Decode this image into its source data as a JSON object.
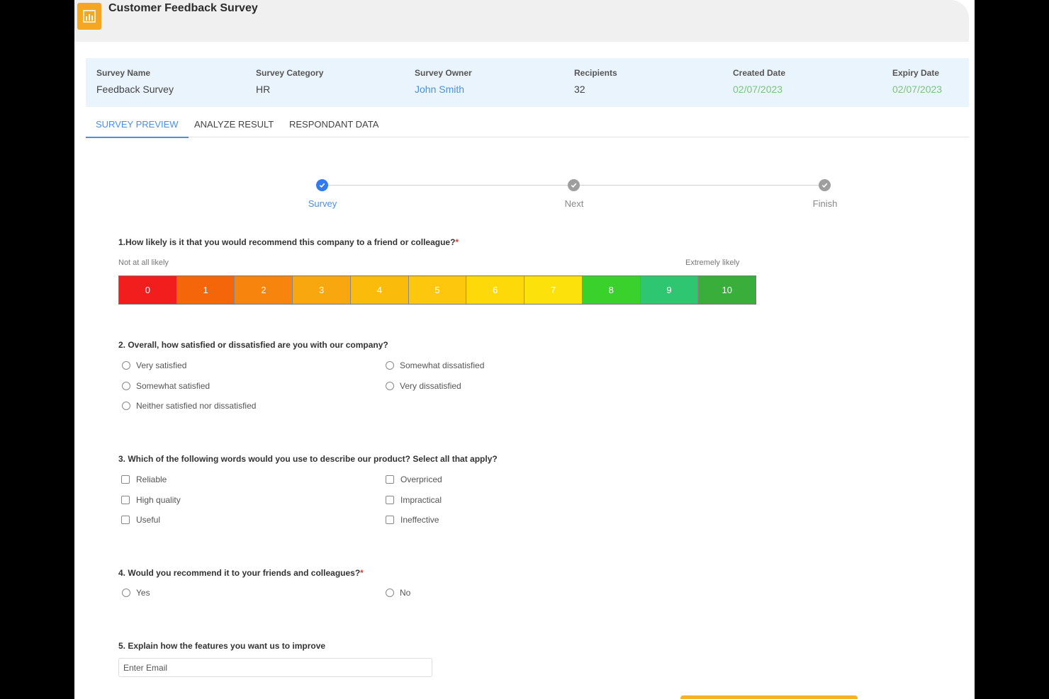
{
  "header": {
    "title": "Customer Feedback Survey"
  },
  "info": [
    {
      "label": "Survey Name",
      "value": "Feedback Survey",
      "style": "plain"
    },
    {
      "label": "Survey Category",
      "value": "HR",
      "style": "plain"
    },
    {
      "label": "Survey Owner",
      "value": "John Smith",
      "style": "link"
    },
    {
      "label": "Recipients",
      "value": "32",
      "style": "plain"
    },
    {
      "label": "Created Date",
      "value": "02/07/2023",
      "style": "green"
    },
    {
      "label": "Expiry Date",
      "value": "02/07/2023",
      "style": "green"
    }
  ],
  "tabs": [
    {
      "label": "SURVEY PREVIEW",
      "active": true
    },
    {
      "label": "ANALYZE RESULT",
      "active": false
    },
    {
      "label": "RESPONDANT DATA",
      "active": false
    }
  ],
  "stepper": [
    {
      "label": "Survey",
      "active": true
    },
    {
      "label": "Next",
      "active": false
    },
    {
      "label": "Finish",
      "active": false
    }
  ],
  "q1": {
    "title": "1.How likely is it that you would recommend this company to a friend or colleague?",
    "required": "*",
    "low_label": "Not at all likely",
    "high_label": "Extremely likely",
    "scale": [
      "0",
      "1",
      "2",
      "3",
      "4",
      "5",
      "6",
      "7",
      "8",
      "9",
      "10"
    ],
    "colors": [
      "#f21d1d",
      "#f5650a",
      "#f7840d",
      "#f9a70f",
      "#fbbb0a",
      "#fcc70c",
      "#fdd90a",
      "#fde10a",
      "#3bd12d",
      "#2fc672",
      "#3aae3a"
    ]
  },
  "q2": {
    "title": "2. Overall, how satisfied or dissatisfied are you with our company?",
    "options": [
      "Very satisfied",
      "Somewhat satisfied",
      "Neither satisfied nor dissatisfied",
      "Somewhat dissatisfied",
      "Very dissatisfied"
    ]
  },
  "q3": {
    "title": "3. Which of the following words would you use to describe our product? Select all that apply?",
    "options": [
      "Reliable",
      "High quality",
      "Useful",
      "Overpriced",
      "Impractical",
      "Ineffective"
    ]
  },
  "q4": {
    "title": "4. Would you recommend it to your friends and colleagues?",
    "required": "*",
    "options": [
      "Yes",
      "No"
    ]
  },
  "q5": {
    "title": "5. Explain how the features you want us to improve",
    "placeholder": "Enter Email"
  }
}
